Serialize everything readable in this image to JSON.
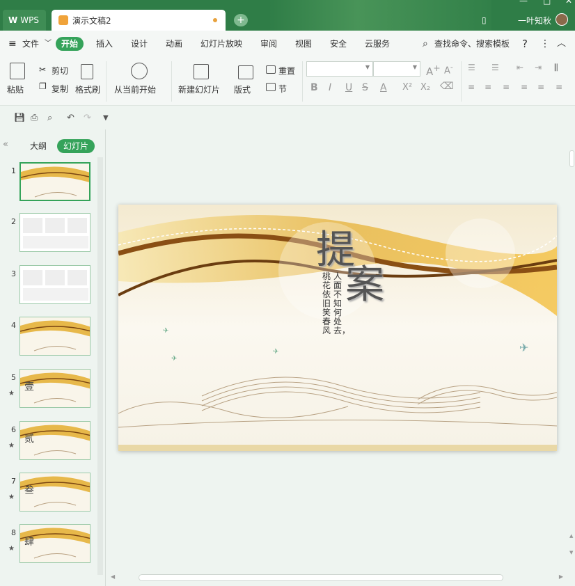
{
  "window": {
    "app_tab": "WPS",
    "doc_tab": "演示文稿2",
    "username": "一叶知秋",
    "brand_color": "#2f7d47",
    "accent_color": "#35a35a"
  },
  "menu": {
    "file": "文件",
    "items": [
      "开始",
      "插入",
      "设计",
      "动画",
      "幻灯片放映",
      "审阅",
      "视图",
      "安全",
      "云服务"
    ],
    "search": "查找命令、搜索模板",
    "help": "?"
  },
  "ribbon": {
    "paste": "粘贴",
    "cut": "剪切",
    "copy": "复制",
    "format_painter": "格式刷",
    "from_current": "从当前开始",
    "new_slide": "新建幻灯片",
    "layout": "版式",
    "reset": "重置",
    "section": "节",
    "font_name": "",
    "font_size": ""
  },
  "panel": {
    "tabs": [
      "大纲",
      "幻灯片"
    ],
    "slides": [
      {
        "num": "1",
        "text": "",
        "star": false
      },
      {
        "num": "2",
        "text": "",
        "star": false
      },
      {
        "num": "3",
        "text": "",
        "star": false
      },
      {
        "num": "4",
        "text": "",
        "star": false
      },
      {
        "num": "5",
        "text": "壹",
        "star": true
      },
      {
        "num": "6",
        "text": "贰",
        "star": true
      },
      {
        "num": "7",
        "text": "叁",
        "star": true
      },
      {
        "num": "8",
        "text": "肆",
        "star": true
      }
    ]
  },
  "slide": {
    "title_1": "提",
    "title_2": "案",
    "poem_col_1": "人面不知何处去，",
    "poem_col_2": "桃花依旧笑春风"
  }
}
